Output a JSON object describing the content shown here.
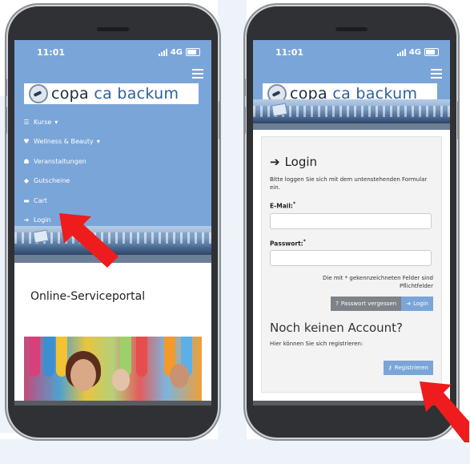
{
  "colors": {
    "brand_blue": "#7aa5d8",
    "arrow_red": "#ee1c1c",
    "logo_accent": "#2b5fa3"
  },
  "status_bar": {
    "time": "11:01",
    "network": "4G"
  },
  "logo": {
    "word1": "copa",
    "word2": "ca",
    "word3": "backum",
    "icon": "swimmer-logo-icon"
  },
  "left_screen": {
    "nav": [
      {
        "label": "Kurse",
        "icon": "list-icon",
        "dropdown": true
      },
      {
        "label": "Wellness & Beauty",
        "icon": "heart-icon",
        "dropdown": true
      },
      {
        "label": "Veranstaltungen",
        "icon": "people-icon",
        "dropdown": false
      },
      {
        "label": "Gutscheine",
        "icon": "tag-icon",
        "dropdown": false
      },
      {
        "label": "Cart",
        "icon": "cart-icon",
        "dropdown": false
      },
      {
        "label": "Login",
        "icon": "sign-in-icon",
        "dropdown": false
      }
    ],
    "portal_title": "Online-Serviceportal"
  },
  "right_screen": {
    "login_title": "Login",
    "login_intro": "Bitte loggen Sie sich mit dem untenstehenden Formular ein.",
    "email_label": "E-Mail:",
    "password_label": "Passwort:",
    "required_mark": "*",
    "required_note": "Die mit * gekennzeichneten Felder sind Pflichtfelder",
    "forgot_button": "Passwort vergessen",
    "login_button": "Login",
    "account_title": "Noch keinen Account?",
    "register_intro": "Hier können Sie sich registrieren:",
    "register_button": "Registrieren"
  }
}
